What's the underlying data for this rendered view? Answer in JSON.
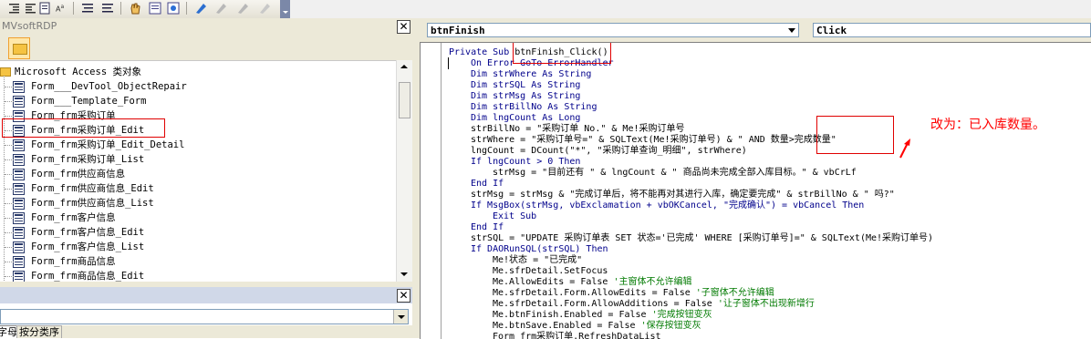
{
  "project_panel": {
    "title": "MVsoftRDP",
    "root_label": "Microsoft Access 类对象",
    "items": [
      {
        "label": "Form___DevTool_ObjectRepair"
      },
      {
        "label": "Form___Template_Form"
      },
      {
        "label": "Form_frm采购订单"
      },
      {
        "label": "Form_frm采购订单_Edit"
      },
      {
        "label": "Form_frm采购订单_Edit_Detail"
      },
      {
        "label": "Form_frm采购订单_List"
      },
      {
        "label": "Form_frm供应商信息"
      },
      {
        "label": "Form_frm供应商信息_Edit"
      },
      {
        "label": "Form_frm供应商信息_List"
      },
      {
        "label": "Form_frm客户信息"
      },
      {
        "label": "Form_frm客户信息_Edit"
      },
      {
        "label": "Form_frm客户信息_List"
      },
      {
        "label": "Form_frm商品信息"
      },
      {
        "label": "Form_frm商品信息_Edit"
      }
    ],
    "tabs": [
      "字母序",
      "按分类序"
    ]
  },
  "code_window": {
    "object_combo": "btnFinish",
    "procedure_combo": "Click",
    "lines": [
      {
        "indent": 0,
        "segments": [
          {
            "t": "Private Sub ",
            "k": "kw"
          },
          {
            "t": "btnFinish_Click()",
            "k": ""
          }
        ]
      },
      {
        "indent": 1,
        "segments": [
          {
            "t": "On Error GoTo ErrorHandler",
            "k": "kw"
          }
        ]
      },
      {
        "indent": 1,
        "segments": [
          {
            "t": "Dim strWhere As String",
            "k": "kw"
          }
        ]
      },
      {
        "indent": 1,
        "segments": [
          {
            "t": "Dim strSQL As String",
            "k": "kw"
          }
        ]
      },
      {
        "indent": 1,
        "segments": [
          {
            "t": "Dim strMsg As String",
            "k": "kw"
          }
        ]
      },
      {
        "indent": 1,
        "segments": [
          {
            "t": "Dim strBillNo As String",
            "k": "kw"
          }
        ]
      },
      {
        "indent": 1,
        "segments": [
          {
            "t": "Dim lngCount As Long",
            "k": "kw"
          }
        ]
      },
      {
        "indent": 1,
        "segments": [
          {
            "t": "strBillNo = \"采购订单 No.\" & Me!采购订单号",
            "k": ""
          }
        ]
      },
      {
        "indent": 1,
        "segments": [
          {
            "t": "strWhere = \"采购订单号=\" & SQLText(Me!采购订单号) & \" AND 数量>完成数量\"",
            "k": ""
          }
        ]
      },
      {
        "indent": 1,
        "segments": [
          {
            "t": "lngCount = DCount(\"*\", \"采购订单查询_明细\", strWhere)",
            "k": ""
          }
        ]
      },
      {
        "indent": 1,
        "segments": [
          {
            "t": "If lngCount > 0 Then",
            "k": "kw"
          }
        ]
      },
      {
        "indent": 2,
        "segments": [
          {
            "t": "strMsg = \"目前还有 \" & lngCount & \" 商品尚未完成全部入库目标。\" & vbCrLf",
            "k": ""
          }
        ]
      },
      {
        "indent": 1,
        "segments": [
          {
            "t": "End If",
            "k": "kw"
          }
        ]
      },
      {
        "indent": 1,
        "segments": [
          {
            "t": "strMsg = strMsg & \"完成订单后，将不能再对其进行入库，确定要完成\" & strBillNo & \" 吗?\"",
            "k": ""
          }
        ]
      },
      {
        "indent": 1,
        "segments": [
          {
            "t": "If MsgBox(strMsg, vbExclamation + vbOKCancel, \"完成确认\") = vbCancel Then",
            "k": "kw"
          }
        ]
      },
      {
        "indent": 2,
        "segments": [
          {
            "t": "Exit Sub",
            "k": "kw"
          }
        ]
      },
      {
        "indent": 1,
        "segments": [
          {
            "t": "End If",
            "k": "kw"
          }
        ]
      },
      {
        "indent": 1,
        "segments": [
          {
            "t": "strSQL = \"UPDATE 采购订单表 SET 状态='已完成' WHERE [采购订单号]=\" & SQLText(Me!采购订单号)",
            "k": ""
          }
        ]
      },
      {
        "indent": 1,
        "segments": [
          {
            "t": "If DAORunSQL(strSQL) Then",
            "k": "kw"
          }
        ]
      },
      {
        "indent": 2,
        "segments": [
          {
            "t": "Me!状态 = \"已完成\"",
            "k": ""
          }
        ]
      },
      {
        "indent": 2,
        "segments": [
          {
            "t": "Me.sfrDetail.SetFocus",
            "k": ""
          }
        ]
      },
      {
        "indent": 2,
        "segments": [
          {
            "t": "Me.AllowEdits = False ",
            "k": ""
          },
          {
            "t": "'主窗体不允许编辑",
            "k": "cm"
          }
        ]
      },
      {
        "indent": 2,
        "segments": [
          {
            "t": "Me.sfrDetail.Form.AllowEdits = False ",
            "k": ""
          },
          {
            "t": "'子窗体不允许编辑",
            "k": "cm"
          }
        ]
      },
      {
        "indent": 2,
        "segments": [
          {
            "t": "Me.sfrDetail.Form.AllowAdditions = False ",
            "k": ""
          },
          {
            "t": "'让子窗体不出现新增行",
            "k": "cm"
          }
        ]
      },
      {
        "indent": 2,
        "segments": [
          {
            "t": "Me.btnFinish.Enabled = False ",
            "k": ""
          },
          {
            "t": "'完成按钮变灰",
            "k": "cm"
          }
        ]
      },
      {
        "indent": 2,
        "segments": [
          {
            "t": "Me.btnSave.Enabled = False ",
            "k": ""
          },
          {
            "t": "'保存按钮变灰",
            "k": "cm"
          }
        ]
      },
      {
        "indent": 2,
        "segments": [
          {
            "t": "Form_frm采购订单.RefreshDataList",
            "k": ""
          }
        ]
      }
    ]
  },
  "annotation": "改为：已入库数量。",
  "colors": {
    "highlight_box": "#e00000",
    "keyword": "#00008b",
    "comment": "#007a00",
    "annotation": "#ff0000"
  }
}
